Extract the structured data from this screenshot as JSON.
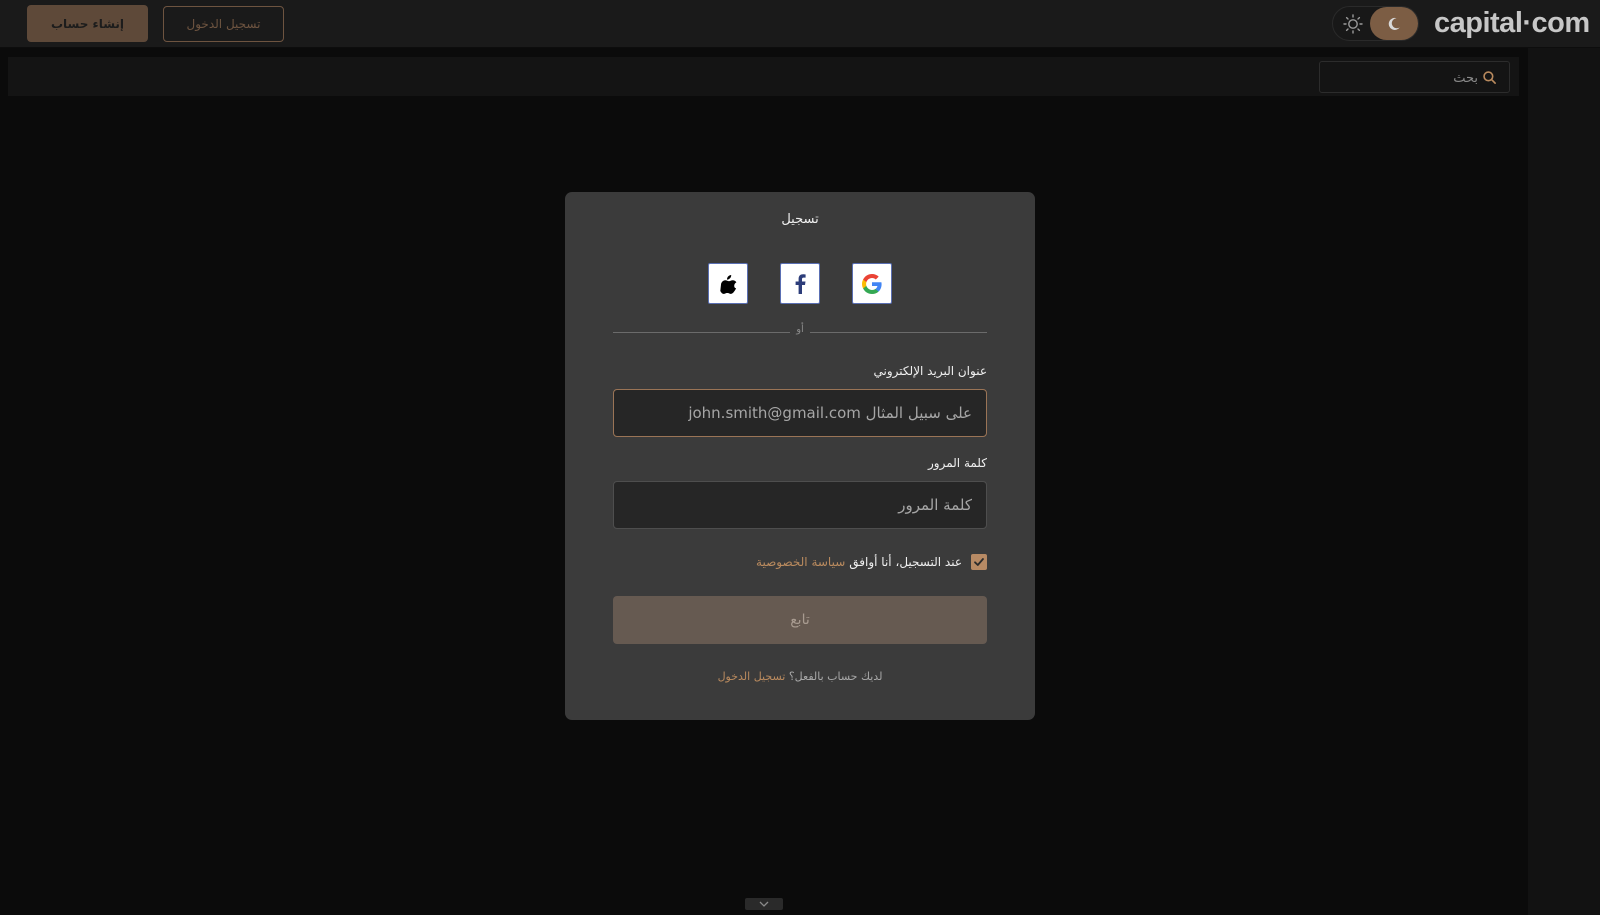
{
  "header": {
    "create_account_label": "إنشاء حساب",
    "login_label": "تسجيل الدخول",
    "logo_text": "capital·com",
    "theme": {
      "active": "dark",
      "sun_icon": "sun-icon",
      "moon_icon": "moon-icon"
    }
  },
  "search": {
    "placeholder": "بحث",
    "value": "",
    "icon": "search-icon"
  },
  "signup_modal": {
    "title": "تسجيل",
    "social_buttons": [
      {
        "provider": "Apple",
        "icon": "apple-icon"
      },
      {
        "provider": "Facebook",
        "icon": "facebook-icon"
      },
      {
        "provider": "Google",
        "icon": "google-icon"
      }
    ],
    "divider_text": "أو",
    "email": {
      "label": "عنوان البريد الإلكتروني",
      "placeholder": "على سبيل المثال john.smith@gmail.com",
      "value": ""
    },
    "password": {
      "label": "كلمة المرور",
      "placeholder": "كلمة المرور",
      "value": ""
    },
    "consent": {
      "checked": true,
      "text": "عند التسجيل، أنا أوافق",
      "link_text": "سياسة الخصوصية"
    },
    "continue_label": "تابع",
    "have_account_text": "لديك حساب بالفعل؟",
    "login_link_text": "تسجيل الدخول"
  },
  "colors": {
    "accent": "#b98a5e",
    "create_button_bg": "#5e4939",
    "modal_bg": "#3b3b3b",
    "page_bg": "#0b0b0b",
    "continue_disabled_bg": "#665a51"
  }
}
